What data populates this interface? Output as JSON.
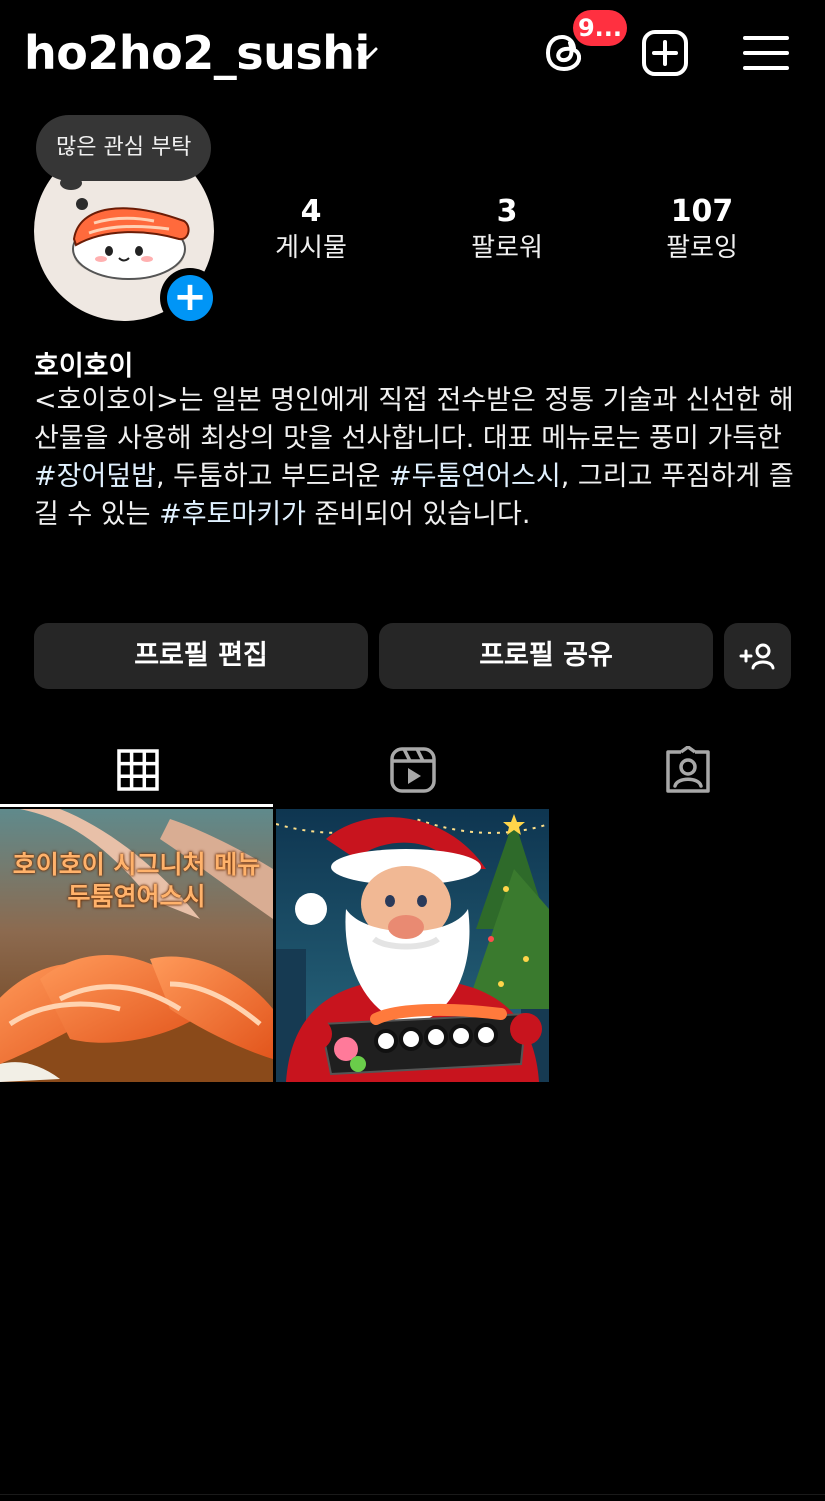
{
  "header": {
    "username": "ho2ho2_sushi",
    "threads_badge": "9..."
  },
  "profile": {
    "note": "많은 관심 부탁",
    "display_name": "호이호이",
    "bio": [
      {
        "t": "<호이호이>는 일본 명인에게 직접 전수받은 정통 기술과 신선한 해산물을 사용해 최상의 맛을 선사합니다. 대표 메뉴로는 풍미 가득한 "
      },
      {
        "t": "#장어덮밥",
        "tag": true
      },
      {
        "t": ", 두툼하고 부드러운 "
      },
      {
        "t": "#두툼연어스시",
        "tag": true
      },
      {
        "t": ", 그리고 푸짐하게 즐길 수 있는 "
      },
      {
        "t": "#후토마키가",
        "tag": true
      },
      {
        "t": " 준비되어 있습니다."
      }
    ]
  },
  "stats": {
    "posts": {
      "value": "4",
      "label": "게시물"
    },
    "followers": {
      "value": "3",
      "label": "팔로워"
    },
    "following": {
      "value": "107",
      "label": "팔로잉"
    }
  },
  "buttons": {
    "edit_profile": "프로필 편집",
    "share_profile": "프로필 공유"
  },
  "tabs": [
    "grid-icon",
    "reels-icon",
    "tagged-icon"
  ],
  "posts": [
    {
      "caption_line1": "호이호이 시그니처 메뉴",
      "caption_line2": "두툼연어스시"
    },
    {}
  ],
  "colors": {
    "background": "#000000",
    "button": "#262626",
    "badge": "#ff3040",
    "link": "#e0f1ff",
    "add": "#0095f6"
  }
}
